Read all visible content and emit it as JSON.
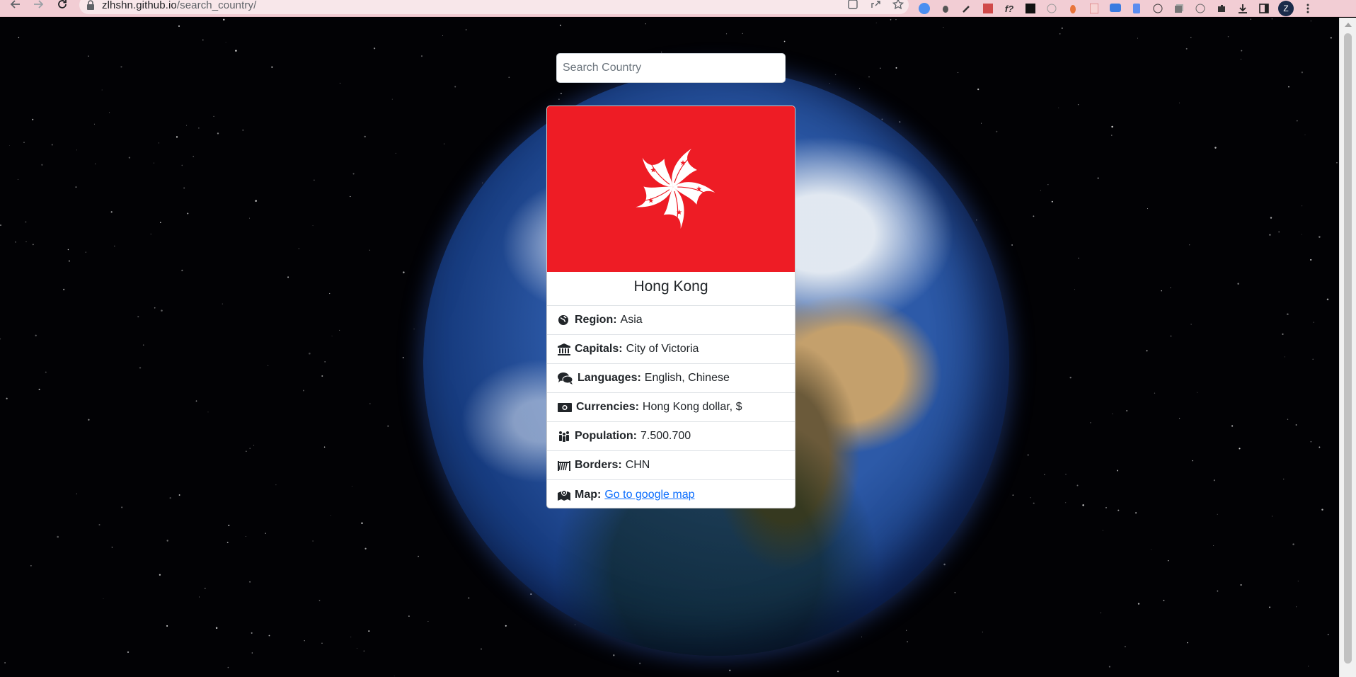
{
  "browser": {
    "url_host": "zlhshn.github.io",
    "url_path": "/search_country/",
    "profile_initial": "Z"
  },
  "search": {
    "placeholder": "Search Country"
  },
  "country": {
    "name": "Hong Kong",
    "flag_colors": {
      "field": "#ee1c25",
      "petal": "#ffffff"
    },
    "fields": [
      {
        "icon": "globe-icon",
        "label": "Region:",
        "value": "Asia"
      },
      {
        "icon": "landmark-icon",
        "label": "Capitals:",
        "value": "City of Victoria"
      },
      {
        "icon": "comments-icon",
        "label": "Languages:",
        "value": "English, Chinese"
      },
      {
        "icon": "money-icon",
        "label": "Currencies:",
        "value": "Hong Kong dollar, $"
      },
      {
        "icon": "people-icon",
        "label": "Population:",
        "value": "7.500.700"
      },
      {
        "icon": "border-icon",
        "label": "Borders:",
        "value": "CHN"
      },
      {
        "icon": "map-icon",
        "label": "Map:",
        "link_text": "Go to google map"
      }
    ]
  }
}
